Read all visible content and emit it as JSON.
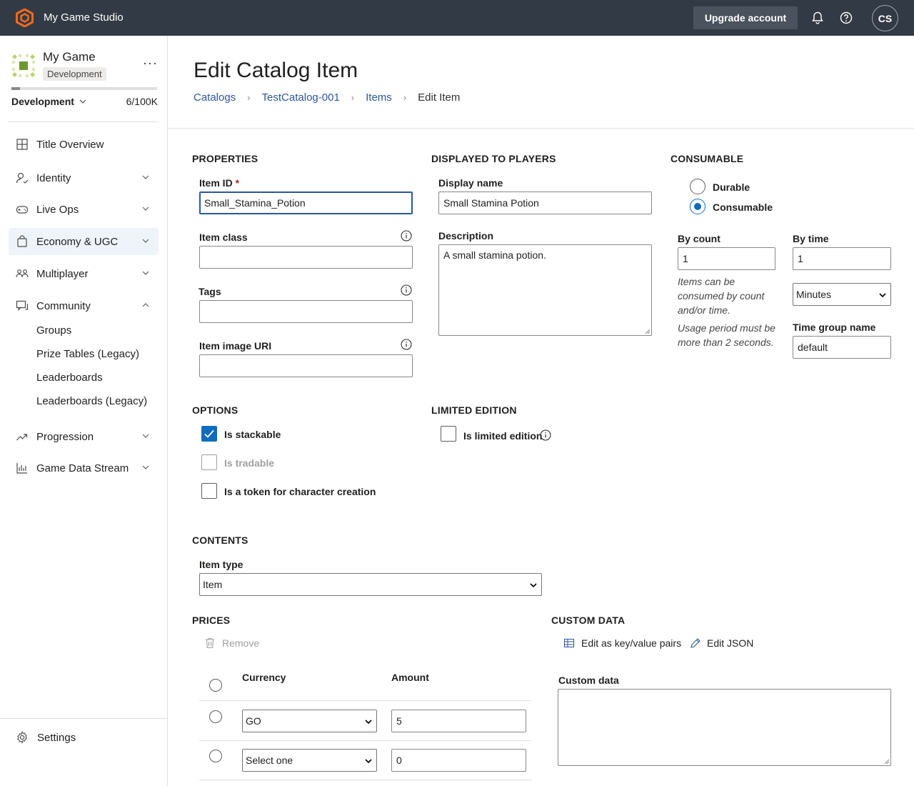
{
  "topbar": {
    "studio_name": "My Game Studio",
    "upgrade_label": "Upgrade account",
    "avatar_initials": "CS",
    "bg_color": "#323a45",
    "logo_color": "#f26b1d"
  },
  "sidebar": {
    "game_name": "My Game",
    "environment_badge": "Development",
    "more_label": "···",
    "environment_select": "Development",
    "usage": "6/100K",
    "usage_fraction": 0.06,
    "nav": [
      {
        "label": "Title Overview",
        "icon": "grid-icon",
        "expandable": false
      },
      {
        "label": "Identity",
        "icon": "identity-icon",
        "expandable": true
      },
      {
        "label": "Live Ops",
        "icon": "gamepad-icon",
        "expandable": true
      },
      {
        "label": "Economy & UGC",
        "icon": "shopping-bag-icon",
        "expandable": true,
        "active": true
      },
      {
        "label": "Multiplayer",
        "icon": "people-icon",
        "expandable": true
      },
      {
        "label": "Community",
        "icon": "chat-icon",
        "expandable": true,
        "expanded": true
      },
      {
        "label": "Progression",
        "icon": "trend-icon",
        "expandable": true
      },
      {
        "label": "Game Data Stream",
        "icon": "bar-chart-icon",
        "expandable": true
      }
    ],
    "community_sub": [
      "Groups",
      "Prize Tables (Legacy)",
      "Leaderboards",
      "Leaderboards (Legacy)"
    ],
    "settings_label": "Settings"
  },
  "page": {
    "title": "Edit Catalog Item",
    "breadcrumb": [
      "Catalogs",
      "TestCatalog-001",
      "Items",
      "Edit Item"
    ]
  },
  "properties": {
    "section": "PROPERTIES",
    "item_id_label": "Item ID",
    "item_id_required": "*",
    "item_id_value": "Small_Stamina_Potion",
    "item_class_label": "Item class",
    "item_class_value": "",
    "tags_label": "Tags",
    "tags_value": "",
    "image_uri_label": "Item image URI",
    "image_uri_value": ""
  },
  "displayed": {
    "section": "DISPLAYED TO PLAYERS",
    "display_name_label": "Display name",
    "display_name_value": "Small Stamina Potion",
    "description_label": "Description",
    "description_value": "A small stamina potion."
  },
  "consumable": {
    "section": "CONSUMABLE",
    "durable_label": "Durable",
    "consumable_label": "Consumable",
    "selected": "Consumable",
    "by_count_label": "By count",
    "by_count_value": "1",
    "by_time_label": "By time",
    "by_time_value": "1",
    "time_unit": "Minutes",
    "hint1": "Items can be consumed by count and/or time.",
    "hint2": "Usage period must be more than 2 seconds.",
    "time_group_label": "Time group name",
    "time_group_value": "default"
  },
  "options": {
    "section": "OPTIONS",
    "stackable_label": "Is stackable",
    "stackable_checked": true,
    "tradable_label": "Is tradable",
    "tradable_checked": false,
    "token_label": "Is a token for character creation",
    "token_checked": false
  },
  "limited": {
    "section": "LIMITED EDITION",
    "label": "Is limited edition",
    "checked": false
  },
  "contents": {
    "section": "CONTENTS",
    "item_type_label": "Item type",
    "item_type_value": "Item"
  },
  "prices": {
    "section": "PRICES",
    "remove_label": "Remove",
    "currency_header": "Currency",
    "amount_header": "Amount",
    "rows": [
      {
        "currency": "GO",
        "amount": "5"
      },
      {
        "currency": "Select one",
        "amount": "0"
      }
    ]
  },
  "custom_data": {
    "section": "CUSTOM DATA",
    "edit_kv_label": "Edit as key/value pairs",
    "edit_json_label": "Edit JSON",
    "label": "Custom data",
    "value": ""
  },
  "colors": {
    "accent": "#0f6cbd",
    "link": "#2b579a",
    "active_nav_bg": "#eff4fa"
  }
}
